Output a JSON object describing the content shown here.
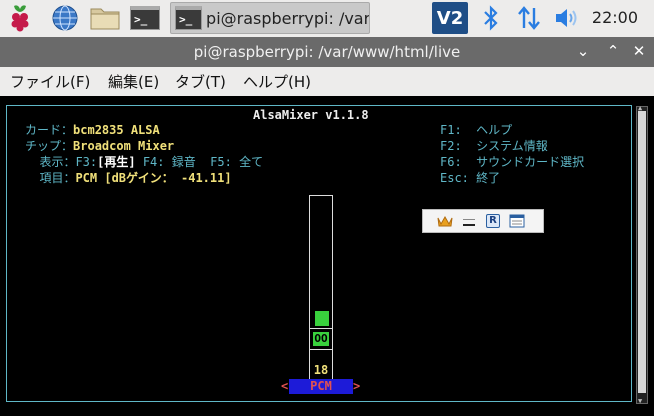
{
  "taskbar": {
    "icons": [
      "raspberry-icon",
      "globe-icon",
      "folder-icon",
      "terminal-icon"
    ],
    "task_title": "pi@raspberrypi: /var/...",
    "tray_vnc": "V2",
    "clock": "22:00"
  },
  "window": {
    "title": "pi@raspberrypi: /var/www/html/live",
    "minimize": "⌄",
    "maximize": "⌃",
    "close": "✕"
  },
  "menu": {
    "file": "ファイル(F)",
    "edit": "編集(E)",
    "tabs": "タブ(T)",
    "help": "ヘルプ(H)"
  },
  "mixer": {
    "title": "AlsaMixer v1.1.8",
    "card_label": "カード：",
    "card_value": "bcm2835 ALSA",
    "chip_label": "チップ：",
    "chip_value": "Broadcom Mixer",
    "view_label": "  表示：",
    "view_f3": "F3:",
    "view_playback": "[再生]",
    "view_f4": " F4: 録音  ",
    "view_f5": "F5: 全て",
    "item_label": "  項目：",
    "item_value": "PCM [dBゲイン： -41.11]",
    "keys": [
      {
        "key": "F1:  ",
        "action": "ヘルプ"
      },
      {
        "key": "F2:  ",
        "action": "システム情報"
      },
      {
        "key": "F6:  ",
        "action": "サウンドカード選択"
      },
      {
        "key": "Esc: ",
        "action": "終了"
      }
    ],
    "control": {
      "name": "PCM",
      "value": "18",
      "level_fraction": 0.1,
      "mute_indicator": "OO",
      "arrow_left": "<",
      "arrow_right": ">"
    },
    "colors": {
      "label": "#5fb7c7",
      "value": "#f0e07a",
      "bar": "#39d13d",
      "control_bg": "#1d1bd8",
      "control_fg": "#e05252"
    }
  },
  "float_toolbar": {
    "icons": [
      "crown-icon",
      "minimize-icon",
      "r-icon",
      "window-icon"
    ],
    "r_label": "R"
  }
}
